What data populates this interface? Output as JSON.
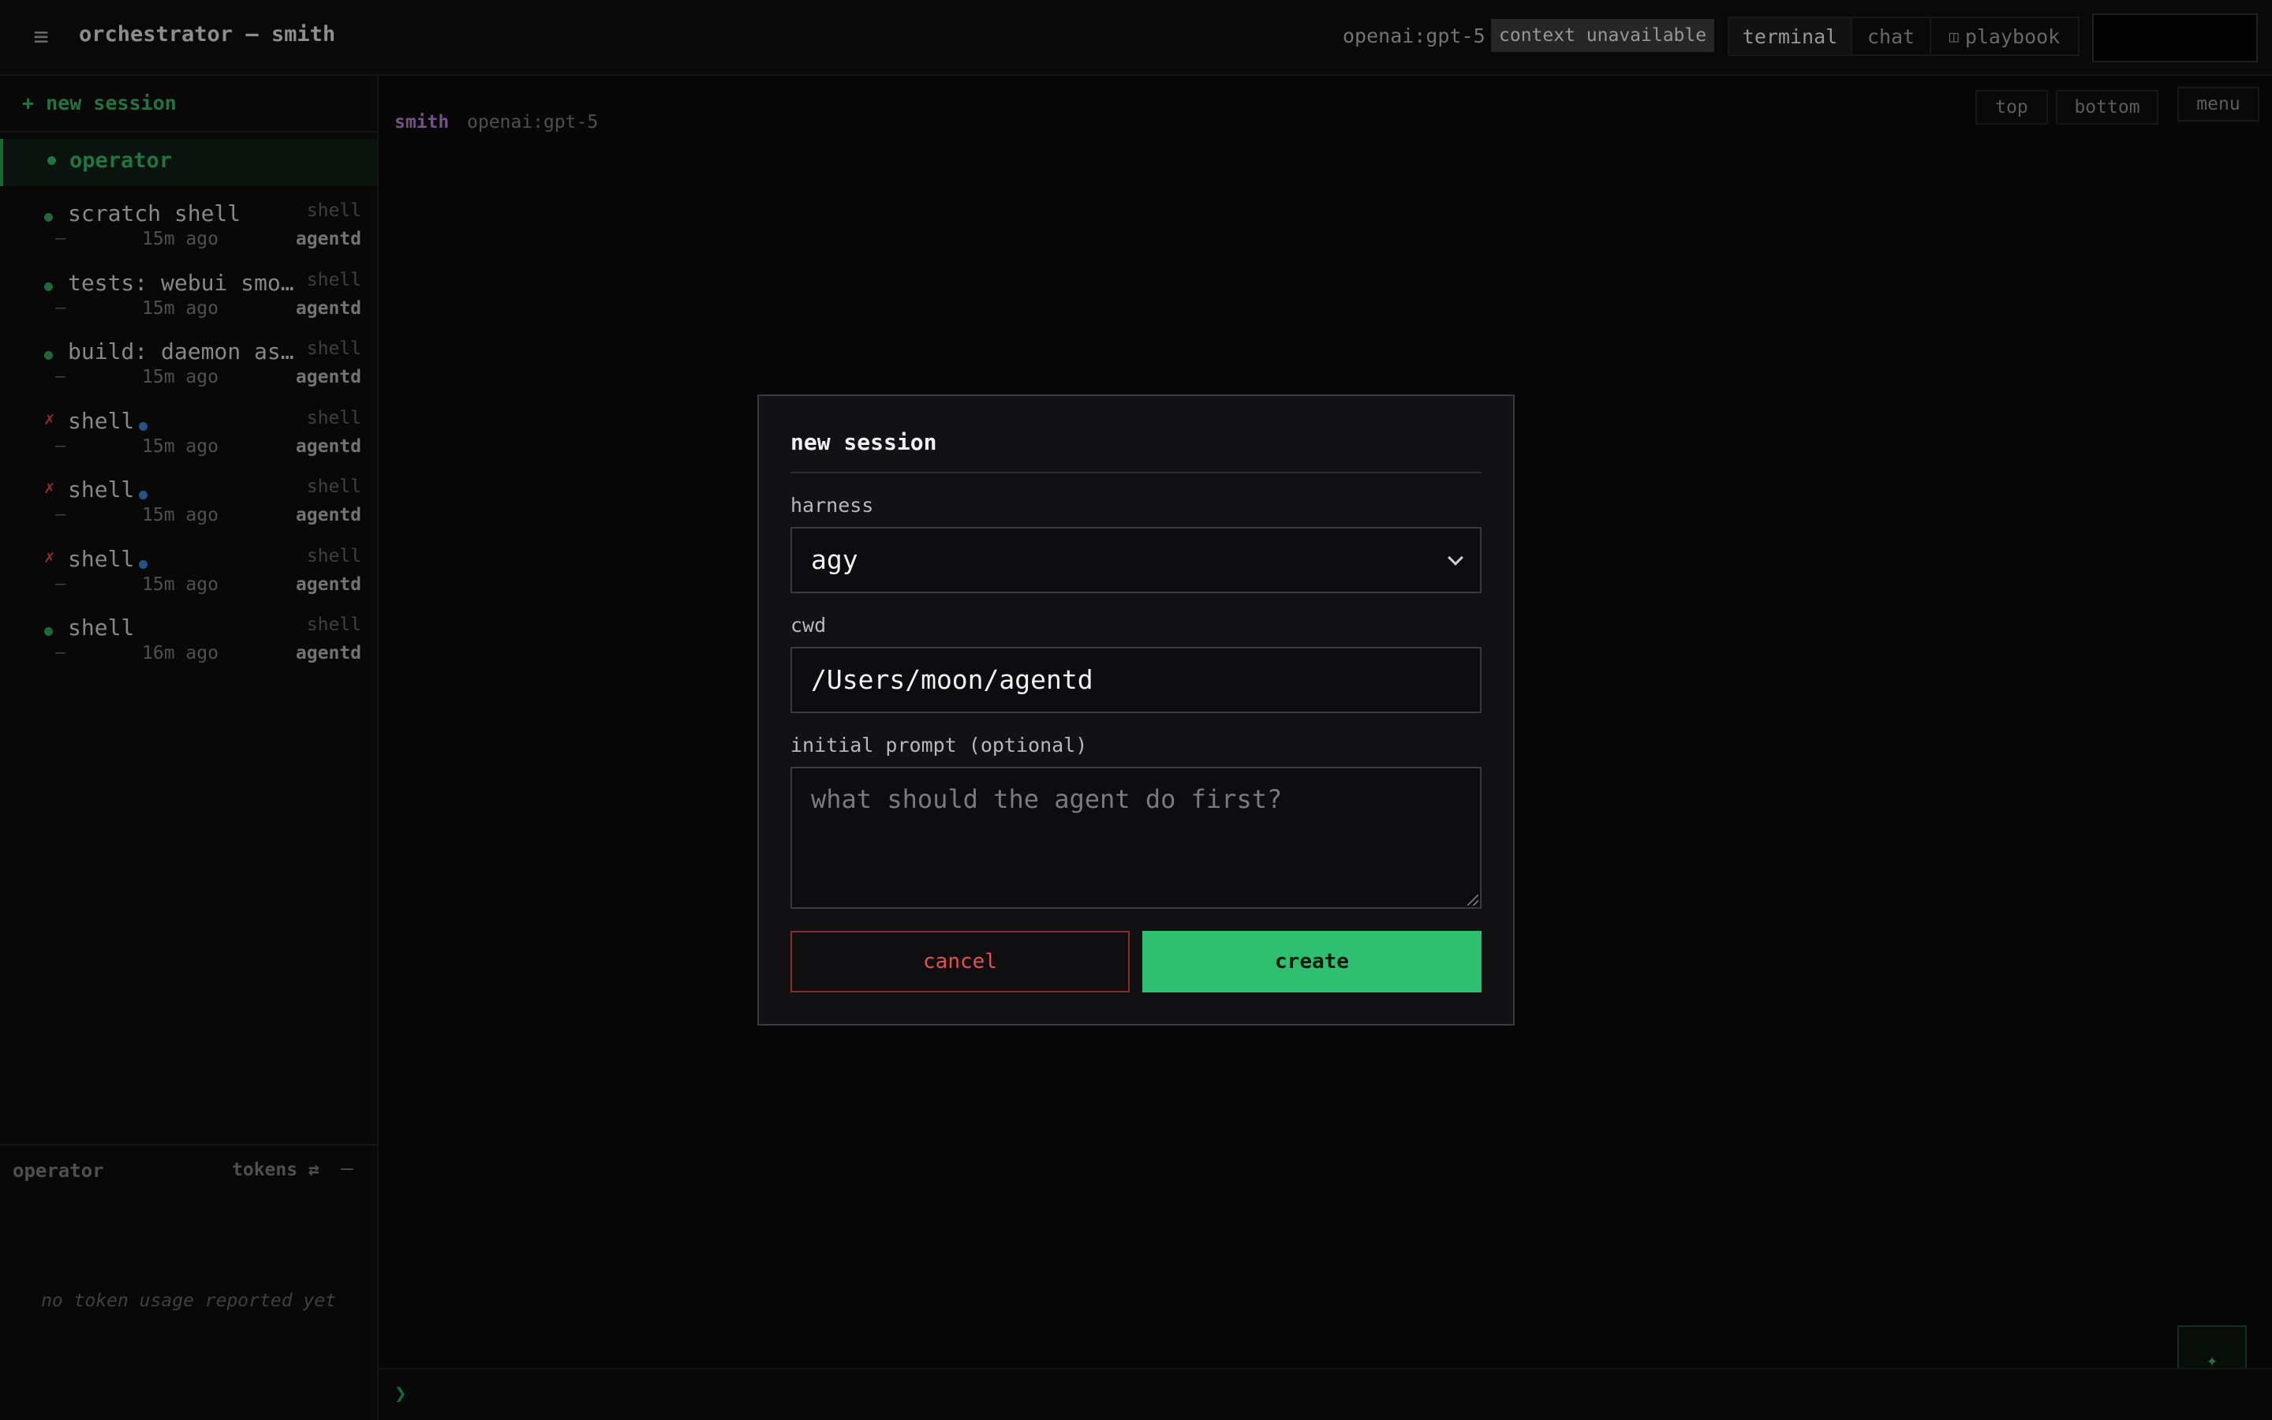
{
  "header": {
    "menu_icon": "hamburger-icon",
    "title": "orchestrator — smith",
    "model": "openai:gpt-5",
    "context_badge": "context unavailable",
    "tabs": [
      {
        "label": "terminal",
        "active": true
      },
      {
        "label": "chat",
        "active": false
      },
      {
        "label": "playbook",
        "active": false,
        "icon": "book-icon",
        "icon_glyph": "◫"
      }
    ]
  },
  "sidebar": {
    "new_session": "+ new session",
    "operator": {
      "name": "operator"
    },
    "sessions": [
      {
        "title": "scratch shell",
        "status": "ok",
        "live": false,
        "kind": "shell",
        "dash": "—",
        "ago": "15m ago",
        "host": "agentd"
      },
      {
        "title": "tests: webui smoke",
        "status": "ok",
        "live": false,
        "kind": "shell",
        "dash": "—",
        "ago": "15m ago",
        "host": "agentd"
      },
      {
        "title": "build: daemon ass…",
        "status": "ok",
        "live": false,
        "kind": "shell",
        "dash": "—",
        "ago": "15m ago",
        "host": "agentd"
      },
      {
        "title": "shell",
        "status": "err",
        "status_glyph": "✗",
        "live": true,
        "kind": "shell",
        "dash": "—",
        "ago": "15m ago",
        "host": "agentd"
      },
      {
        "title": "shell",
        "status": "err",
        "status_glyph": "✗",
        "live": true,
        "kind": "shell",
        "dash": "—",
        "ago": "15m ago",
        "host": "agentd"
      },
      {
        "title": "shell",
        "status": "err",
        "status_glyph": "✗",
        "live": true,
        "kind": "shell",
        "dash": "—",
        "ago": "15m ago",
        "host": "agentd"
      },
      {
        "title": "shell",
        "status": "ok",
        "live": false,
        "kind": "shell",
        "dash": "—",
        "ago": "16m ago",
        "host": "agentd"
      }
    ],
    "token_panel": {
      "title": "operator",
      "toggle": "tokens ⇄",
      "collapse": "—",
      "empty": "no token usage reported yet"
    }
  },
  "main": {
    "agent_name": "smith",
    "agent_model": "openai:gpt-5",
    "btn_top": "top",
    "btn_bottom": "bottom",
    "btn_menu": "menu",
    "prompt_caret": "❯",
    "fab_icon": "sparkle-icon",
    "fab_glyph": "✦"
  },
  "modal": {
    "title": "new session",
    "harness_label": "harness",
    "harness_value": "agy",
    "cwd_label": "cwd",
    "cwd_value": "/Users/moon/agentd",
    "prompt_label": "initial prompt (optional)",
    "prompt_placeholder": "what should the agent do first?",
    "cancel": "cancel",
    "create": "create"
  },
  "colors": {
    "accent_green": "#2fbf71",
    "danger_red": "#e05050",
    "live_blue": "#2d6fb4",
    "agent_purple": "#9a6fb4"
  }
}
